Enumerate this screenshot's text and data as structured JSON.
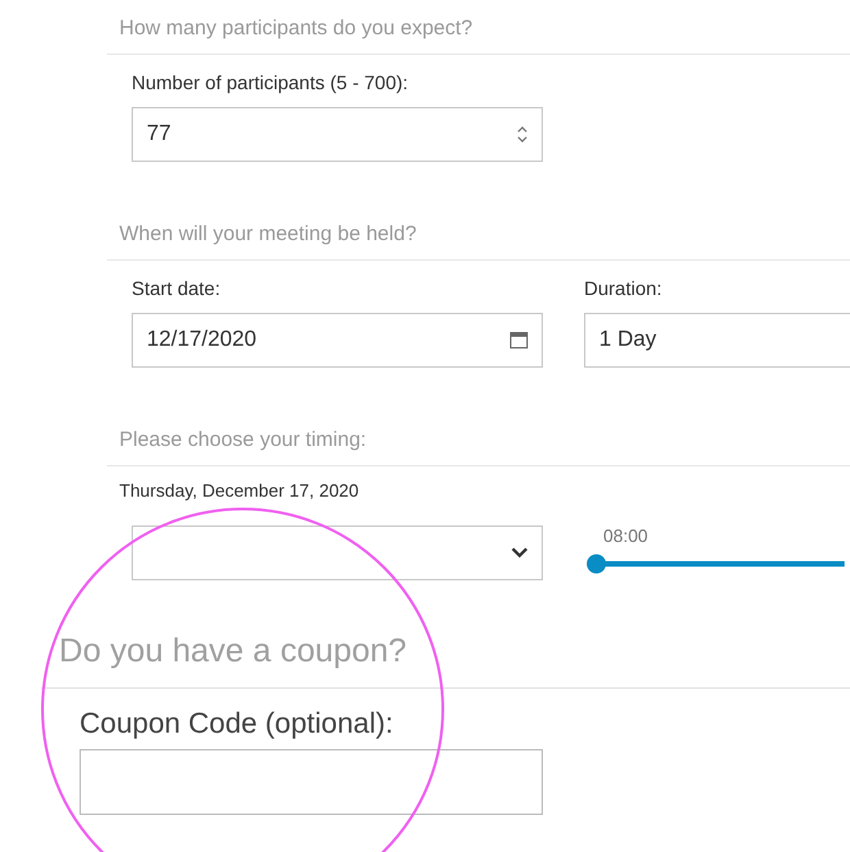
{
  "participants": {
    "heading": "How many participants do you expect?",
    "label": "Number of participants (5 - 700):",
    "value": "77"
  },
  "meeting": {
    "heading": "When will your meeting be held?",
    "start_label": "Start date:",
    "start_value": "12/17/2020",
    "duration_label": "Duration:",
    "duration_value": "1 Day"
  },
  "timing": {
    "heading": "Please choose your timing:",
    "date": "Thursday, December 17, 2020",
    "slider": {
      "label": "08:00",
      "level": 0
    }
  },
  "coupon": {
    "heading": "Do you have a coupon?",
    "label": "Coupon Code (optional):"
  }
}
